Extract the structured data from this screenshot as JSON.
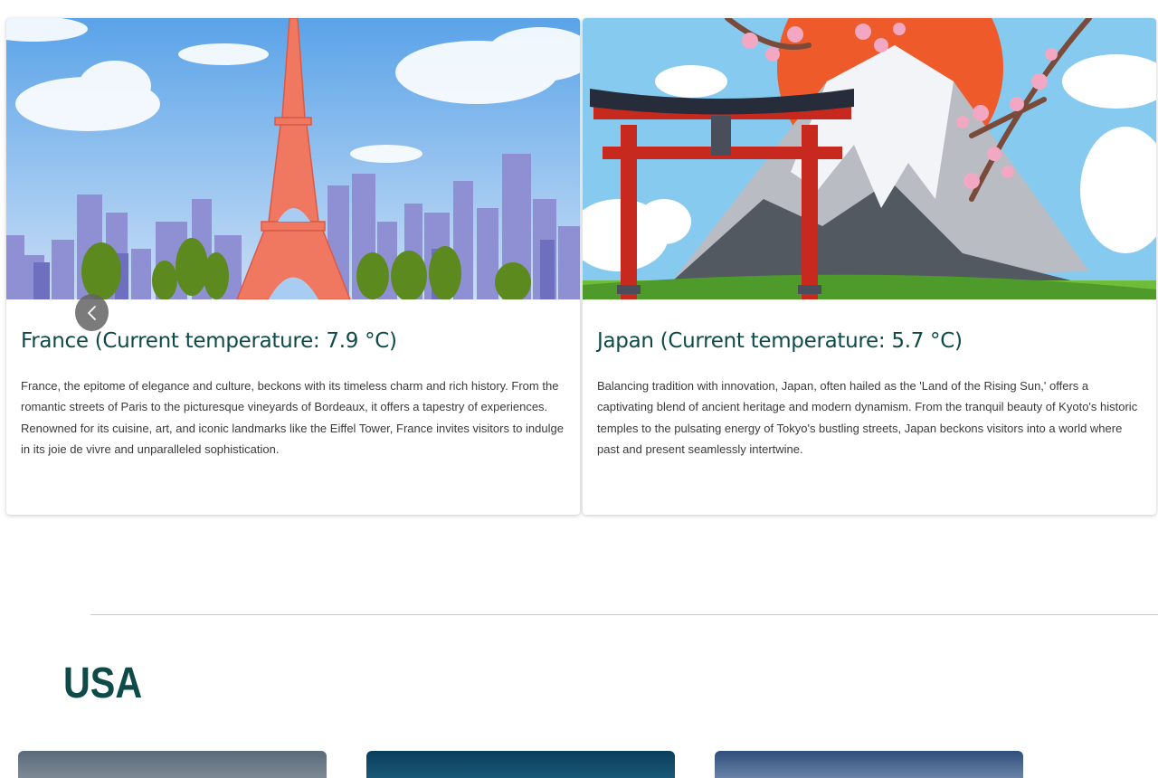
{
  "cards": [
    {
      "title": "France (Current temperature: 7.9 °C)",
      "description": "France, the epitome of elegance and culture, beckons with its timeless charm and rich history. From the romantic streets of Paris to the picturesque vineyards of Bordeaux, it offers a tapestry of experiences. Renowned for its cuisine, art, and iconic landmarks like the Eiffel Tower, France invites visitors to indulge in its joie de vivre and unparalleled sophistication.",
      "image_icon": "eiffel-tower-illustration"
    },
    {
      "title": "Japan (Current temperature: 5.7 °C)",
      "description": "Balancing tradition with innovation, Japan, often hailed as the 'Land of the Rising Sun,' offers a captivating blend of ancient heritage and modern dynamism. From the tranquil beauty of Kyoto's historic temples to the pulsating energy of Tokyo's bustling streets, Japan beckons visitors into a world where past and present seamlessly intertwine.",
      "image_icon": "mount-fuji-torii-illustration"
    }
  ],
  "carousel": {
    "prev_icon": "chevron-left-icon"
  },
  "section": {
    "heading": "USA"
  },
  "colors": {
    "heading": "#0e4a47",
    "body_text": "#3a3a3a",
    "divider": "#c9c9c9"
  }
}
